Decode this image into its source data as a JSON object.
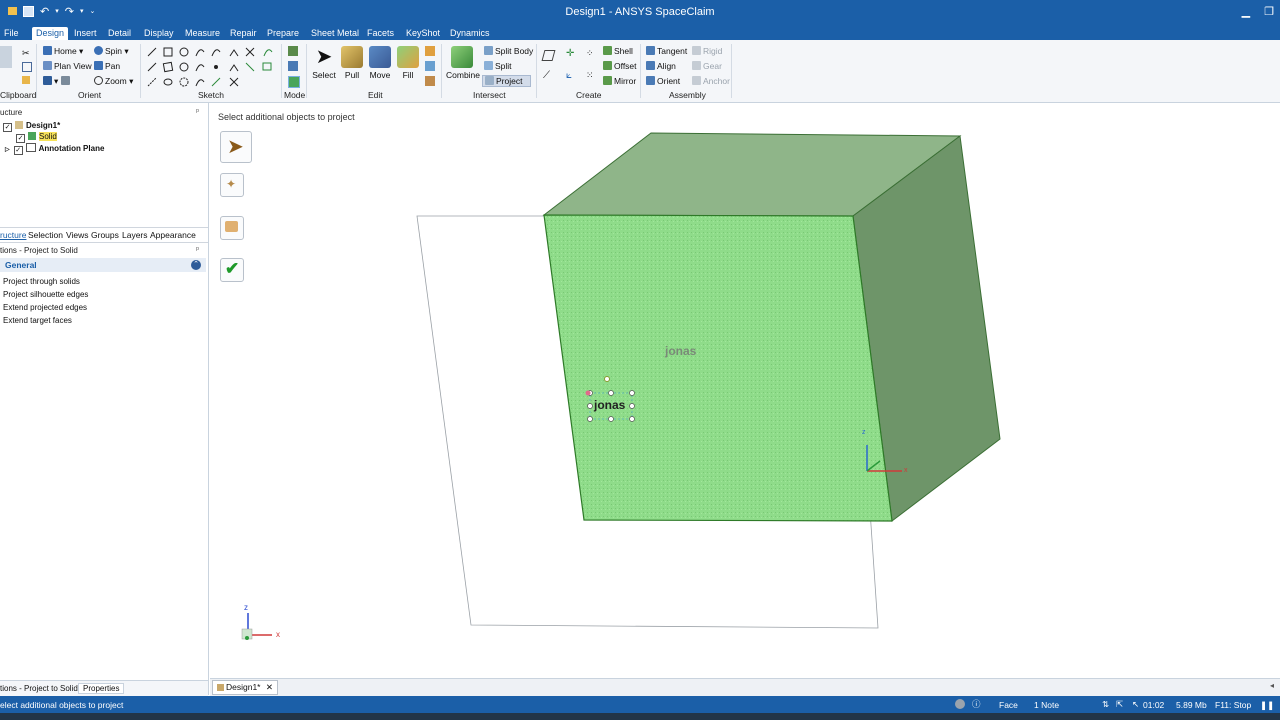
{
  "window": {
    "title": "Design1 - ANSYS SpaceClaim"
  },
  "tabs": [
    "File",
    "Design",
    "Insert",
    "Detail",
    "Display",
    "Measure",
    "Repair",
    "Prepare",
    "Sheet Metal",
    "Facets",
    "KeyShot",
    "Dynamics"
  ],
  "ribbon": {
    "clipboard_label": "Clipboard",
    "orient": {
      "label": "Orient",
      "home": "Home",
      "spin": "Spin",
      "plan_view": "Plan View",
      "pan": "Pan",
      "zoom": "Zoom"
    },
    "sketch_label": "Sketch",
    "mode_label": "Mode",
    "edit": {
      "label": "Edit",
      "select": "Select",
      "pull": "Pull",
      "move": "Move",
      "fill": "Fill"
    },
    "intersect": {
      "label": "Intersect",
      "combine": "Combine",
      "split_body": "Split Body",
      "split": "Split",
      "project": "Project"
    },
    "create": {
      "label": "Create",
      "shell": "Shell",
      "offset": "Offset",
      "mirror": "Mirror"
    },
    "assembly": {
      "label": "Assembly",
      "tangent": "Tangent",
      "align": "Align",
      "orient": "Orient",
      "rigid": "Rigid",
      "gear": "Gear",
      "anchor": "Anchor"
    }
  },
  "left_panel": {
    "structure_header": "ucture",
    "tree": [
      {
        "label": "Design1*"
      },
      {
        "label": "Solid"
      },
      {
        "label": "Annotation Plane"
      }
    ],
    "tabs": [
      "ructure",
      "Selection",
      "Views",
      "Groups",
      "Layers",
      "Appearance"
    ],
    "options_header": "tions - Project to Solid",
    "general": "General",
    "options": [
      "Project through solids",
      "Project silhouette edges",
      "Extend projected edges",
      "Extend target faces"
    ],
    "bottom_tabs": [
      "tions - Project to Solid",
      "Properties"
    ]
  },
  "viewport": {
    "prompt": "Select additional objects to project",
    "text_projected": "jonas",
    "text_selected": "jonas",
    "triad": {
      "z": "z",
      "x": "x"
    },
    "corner_triad": {
      "z": "z",
      "x": "x"
    }
  },
  "doc_tab": {
    "label": "Design1*"
  },
  "status": {
    "left": "elect additional objects to project",
    "face": "Face",
    "notes": "1 Note",
    "time": "01:02",
    "memory": "5.89 Mb",
    "stop": "F11: Stop"
  },
  "colors": {
    "brand": "#1b5fa8",
    "face_front": "#8fdc8a",
    "face_top": "#8fb589",
    "face_side": "#6e9569"
  }
}
